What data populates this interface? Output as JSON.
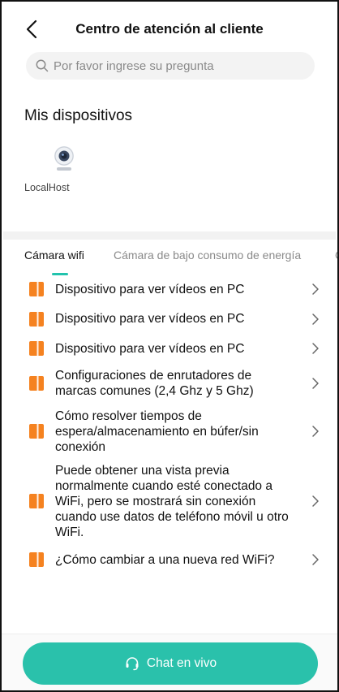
{
  "header": {
    "title": "Centro de atención al cliente",
    "back_icon": "chevron-left-icon"
  },
  "search": {
    "placeholder": "Por favor ingrese su pregunta",
    "icon": "search-icon"
  },
  "devices_section": {
    "title": "Mis dispositivos",
    "devices": [
      {
        "name": "LocalHost",
        "icon": "webcam-icon"
      }
    ]
  },
  "tabs": [
    {
      "label": "Cámara wifi",
      "active": true
    },
    {
      "label": "Cámara de bajo consumo de energía",
      "active": false
    },
    {
      "label": "C",
      "active": false
    }
  ],
  "faq": [
    {
      "text": "Dispositivo para ver vídeos en PC"
    },
    {
      "text": "Dispositivo para ver vídeos en PC"
    },
    {
      "text": "Dispositivo para ver vídeos en PC"
    },
    {
      "text": "Configuraciones de enrutadores de marcas comunes (2,4 Ghz y 5 Ghz)"
    },
    {
      "text": "Cómo resolver tiempos de espera/almacenamiento en búfer/sin conexión"
    },
    {
      "text": "Puede obtener una vista previa normalmente cuando esté conectado a WiFi, pero se mostrará sin conexión cuando use datos de teléfono móvil u otro WiFi."
    },
    {
      "text": "¿Cómo cambiar a una nueva red WiFi?"
    }
  ],
  "chat": {
    "label": "Chat en vivo",
    "icon": "headset-icon"
  },
  "colors": {
    "accent": "#2ac1ab",
    "doc_icon": "#f58220"
  }
}
